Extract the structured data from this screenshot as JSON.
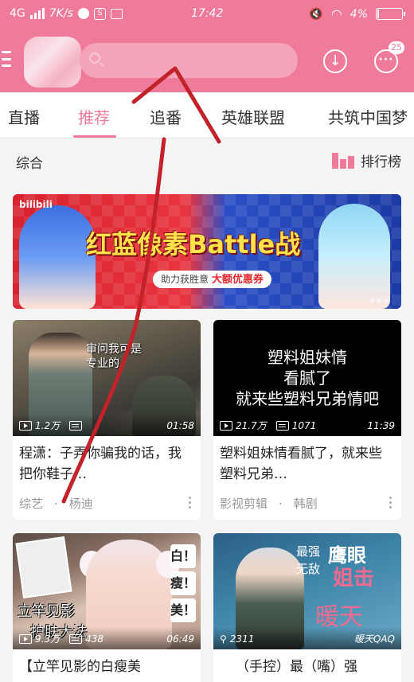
{
  "status_bar": {
    "network": "4G",
    "speed": "7K/s",
    "time": "17:42",
    "battery": "4%",
    "s_box": "S"
  },
  "app_bar": {
    "message_badge": "25",
    "download_icon": "download-icon",
    "message_icon": "message-icon"
  },
  "tabs": [
    {
      "label": "直播",
      "active": false
    },
    {
      "label": "推荐",
      "active": true
    },
    {
      "label": "追番",
      "active": false
    },
    {
      "label": "英雄联盟",
      "active": false
    },
    {
      "label": "共筑中国梦",
      "active": false
    }
  ],
  "section": {
    "title": "综合",
    "ranking_label": "排行榜"
  },
  "banner": {
    "logo": "bilibili",
    "title": "红蓝像素Battle战",
    "subtitle_prefix": "助力获胜意",
    "subtitle_highlight": "大额优惠券"
  },
  "cards": [
    {
      "thumb_caption": "审问我可是\n专业的",
      "views": "1.2万",
      "danmaku": "",
      "duration": "01:58",
      "title": "程潇：子弄你骗我的话，我把你鞋子…",
      "category": "综艺",
      "tag": "杨迪"
    },
    {
      "thumb_caption": "塑料姐妹情\n看腻了\n就来些塑料兄弟情吧",
      "views": "21.7万",
      "danmaku": "1071",
      "duration": "11:39",
      "title": "塑料姐妹情看腻了，就来些塑料兄弟…",
      "category": "影视剪辑",
      "tag": "韩剧"
    },
    {
      "thumb_caption": "立竿见影",
      "thumb_caption2": "护肤大法",
      "stickers": [
        "白！",
        "瘦！",
        "美！"
      ],
      "views": "9.3万",
      "danmaku": "438",
      "duration": "06:49",
      "title": "【立竿见影的白瘦美",
      "category": "",
      "tag": ""
    },
    {
      "thumb_words": [
        "最强",
        "鹰眼",
        "无敌",
        "姐击",
        "暖天"
      ],
      "views": "2311",
      "danmaku": "",
      "duration": "暖天QAQ",
      "title": "（手控）最（嘴）强",
      "category": "",
      "tag": ""
    }
  ],
  "colors": {
    "brand_pink": "#f07a99",
    "annotation_red": "#c2222a"
  }
}
